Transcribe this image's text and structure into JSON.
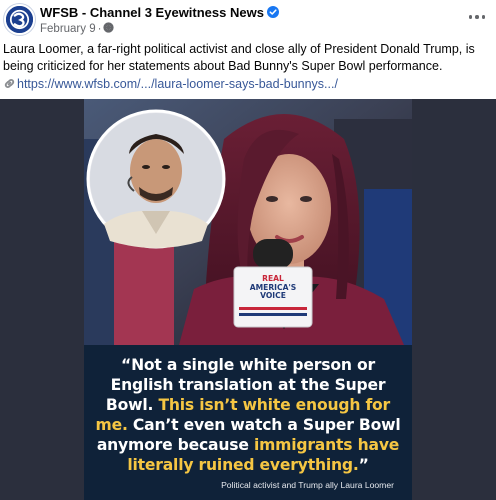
{
  "post": {
    "page_name": "WFSB - Channel 3 Eyewitness News",
    "date": "February 9",
    "separator": "·",
    "text": "Laura Loomer, a far-right political activist and close ally of President Donald Trump, is being criticized for her statements about Bad Bunny's Super Bowl performance.",
    "link_text": "https://www.wfsb.com/.../laura-loomer-says-bad-bunnys.../",
    "icons": {
      "avatar": "channel-3-logo",
      "verified": "verified-badge-icon",
      "audience": "globe-icon",
      "more": "more-options-icon",
      "link": "link-icon"
    }
  },
  "image": {
    "mic_flag_lines": [
      "REAL",
      "AMERICA'S",
      "VOICE"
    ],
    "quote_parts": [
      {
        "text": "“Not a single white person or English translation at the Super Bowl. ",
        "highlight": false
      },
      {
        "text": "This isn’t white enough for me.",
        "highlight": true
      },
      {
        "text": " Can’t even watch a Super Bowl anymore because ",
        "highlight": false
      },
      {
        "text": "immigrants have literally ruined everything.",
        "highlight": true
      },
      {
        "text": "”",
        "highlight": false
      }
    ],
    "caption": "Political activist and Trump ally Laura Loomer"
  },
  "colors": {
    "highlight": "#f5c643",
    "quote_bg": "#0f2239",
    "link": "#385898",
    "verified": "#1877f2"
  }
}
